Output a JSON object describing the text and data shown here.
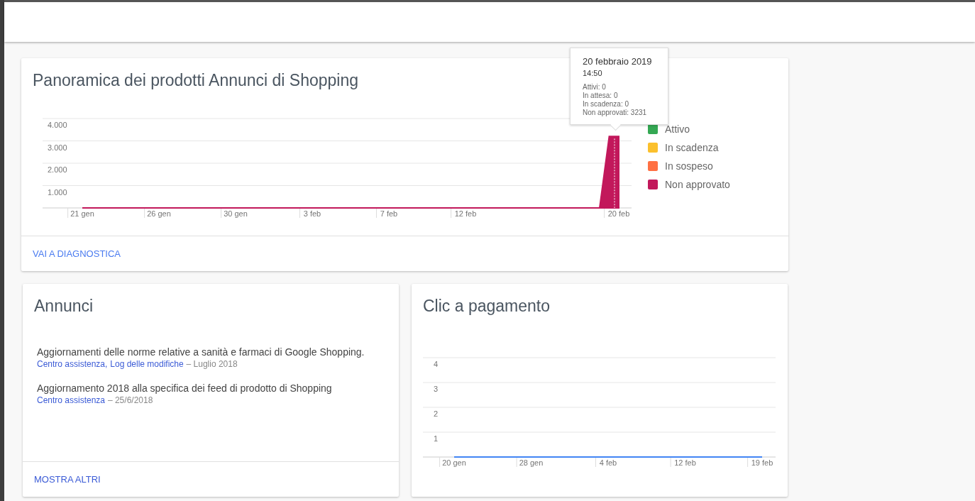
{
  "overview": {
    "title": "Panoramica dei prodotti Annunci di Shopping",
    "chart_data": {
      "type": "area",
      "grid": true,
      "categories": [
        "21 gen",
        null,
        null,
        null,
        null,
        null,
        null,
        null,
        "26 gen",
        null,
        null,
        null,
        null,
        null,
        null,
        null,
        "30 gen",
        null,
        null,
        null,
        null,
        null,
        null,
        null,
        "3 feb",
        null,
        null,
        null,
        null,
        null,
        null,
        null,
        "7 feb",
        null,
        null,
        null,
        null,
        null,
        null,
        null,
        "12 feb",
        null,
        null,
        null,
        null,
        null,
        null,
        null,
        null,
        null,
        null,
        null,
        null,
        null,
        null,
        null,
        "20 feb"
      ],
      "series": [
        {
          "color": "#c2185b",
          "values": [
            0,
            0,
            0,
            0,
            0,
            0,
            0,
            0,
            0,
            0,
            0,
            0,
            0,
            0,
            0,
            0,
            0,
            0,
            0,
            0,
            0,
            0,
            0,
            0,
            0,
            0,
            0,
            0,
            0,
            0,
            0,
            0,
            0,
            0,
            0,
            0,
            0,
            0,
            0,
            0,
            0,
            0,
            0,
            0,
            0,
            0,
            0,
            0,
            0,
            0,
            0,
            0,
            0,
            0,
            0,
            3200,
            3200
          ]
        }
      ],
      "ylim": [
        0,
        4000
      ],
      "yticks": [
        {
          "value": 1000,
          "label": "1.000"
        },
        {
          "value": 2000,
          "label": "2.000"
        },
        {
          "value": 3000,
          "label": "3.000"
        },
        {
          "value": 4000,
          "label": "4.000"
        }
      ]
    },
    "legend": [
      {
        "name": "Attivo",
        "color": "#34a853"
      },
      {
        "name": "In scadenza",
        "color": "#fbc02d"
      },
      {
        "name": "In sospeso",
        "color": "#ff7043"
      },
      {
        "name": "Non approvato",
        "color": "#c2185b"
      }
    ],
    "tooltip": {
      "date": "20 febbraio 2019",
      "time": "14:50",
      "lines": [
        "Attivi: 0",
        "In attesa: 0",
        "In scadenza: 0",
        "Non approvati: 3231"
      ]
    },
    "link": "VAI A DIAGNOSTICA"
  },
  "announcements": {
    "title": "Annunci",
    "items": [
      {
        "text": "Aggiornamenti delle norme relative a sanità e farmaci di Google Shopping.",
        "links": [
          "Centro assistenza,",
          "Log delle modifiche"
        ],
        "date": "– Luglio 2018"
      },
      {
        "text": "Aggiornamento 2018 alla specifica dei feed di prodotto di Shopping",
        "links": [
          "Centro assistenza"
        ],
        "date": "– 25/6/2018"
      }
    ],
    "link": "MOSTRA ALTRI"
  },
  "clicks": {
    "title": "Clic a pagamento",
    "chart_data": {
      "type": "line",
      "grid": true,
      "categories": [
        "20 gen",
        "28 gen",
        "4 feb",
        "12 feb",
        "19 feb"
      ],
      "series": [
        {
          "color": "#4285f4",
          "values": [
            0,
            0,
            0,
            0,
            0
          ]
        }
      ],
      "ylim": [
        0,
        4
      ],
      "yticks": [
        {
          "value": 1,
          "label": "1"
        },
        {
          "value": 2,
          "label": "2"
        },
        {
          "value": 3,
          "label": "3"
        },
        {
          "value": 4,
          "label": "4"
        }
      ]
    }
  }
}
